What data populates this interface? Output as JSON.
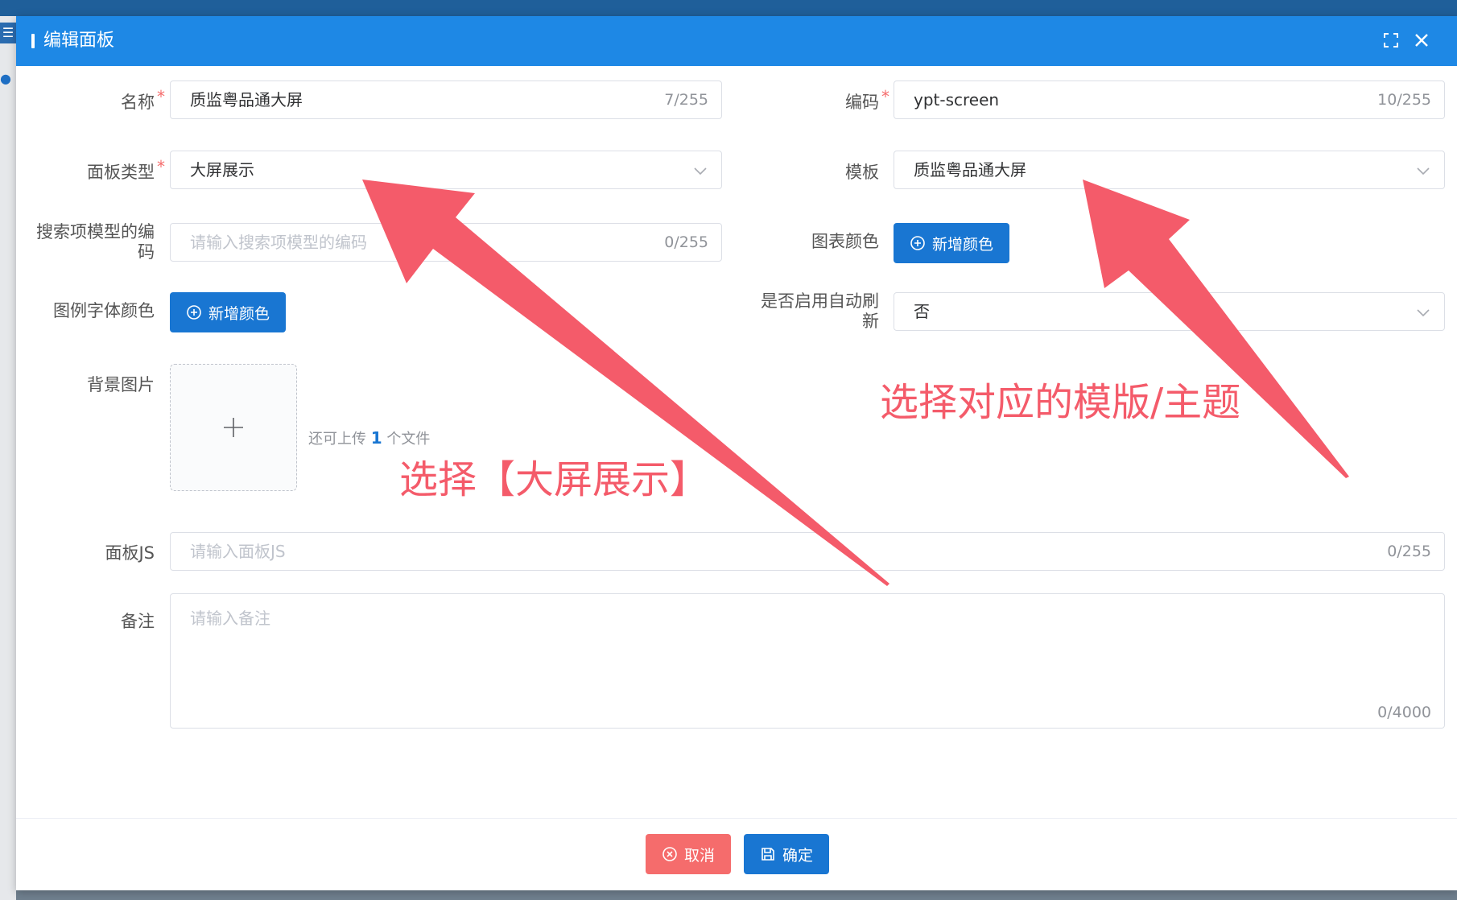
{
  "colors": {
    "header": "#1e88e5",
    "primary": "#1976d2",
    "danger": "#f56c6c",
    "annotation": "#f45b6a"
  },
  "dialog": {
    "title": "编辑面板",
    "icons": {
      "fullscreen": "fullscreen-icon",
      "close": "close-icon"
    }
  },
  "form": {
    "name": {
      "label": "名称",
      "required_mark": "*",
      "value": "质监粤品通大屏",
      "counter": "7/255"
    },
    "code": {
      "label": "编码",
      "required_mark": "*",
      "value": "ypt-screen",
      "counter": "10/255"
    },
    "panel_type": {
      "label": "面板类型",
      "required_mark": "*",
      "value": "大屏展示"
    },
    "template": {
      "label": "模板",
      "value": "质监粤品通大屏"
    },
    "search_model": {
      "label_line1": "搜索项模型的编",
      "label_line2": "码",
      "placeholder": "请输入搜索项模型的编码",
      "counter": "0/255"
    },
    "chart_color": {
      "label": "图表颜色",
      "button": "新增颜色"
    },
    "legend_font_color": {
      "label": "图例字体颜色",
      "button": "新增颜色"
    },
    "auto_refresh": {
      "label_line1": "是否启用自动刷",
      "label_line2": "新",
      "value": "否"
    },
    "background_image": {
      "label": "背景图片",
      "hint_prefix": "还可上传",
      "hint_count": "1",
      "hint_suffix": "个文件"
    },
    "panel_js": {
      "label": "面板JS",
      "placeholder": "请输入面板JS",
      "counter": "0/255"
    },
    "remark": {
      "label": "备注",
      "placeholder": "请输入备注",
      "counter": "0/4000"
    }
  },
  "footer": {
    "cancel": "取消",
    "confirm": "确定"
  },
  "annotations": {
    "left": "选择【大屏展示】",
    "right": "选择对应的模版/主题"
  }
}
